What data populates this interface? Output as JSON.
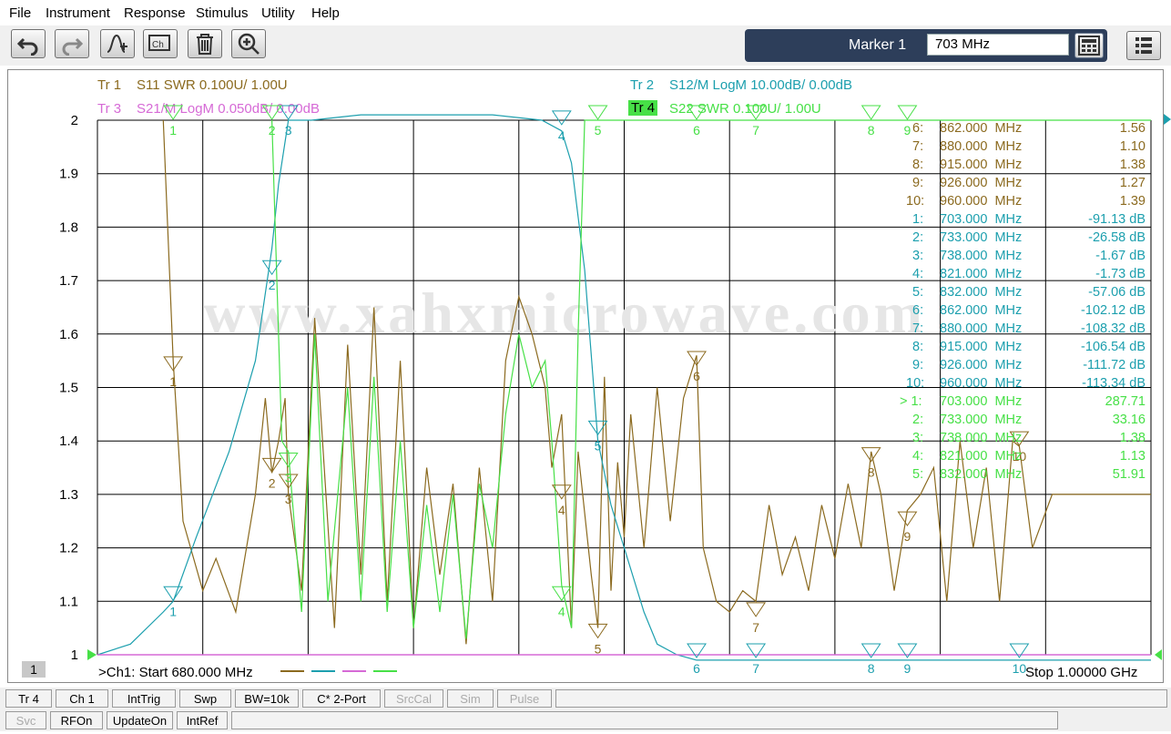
{
  "menu": [
    "File",
    "Instrument",
    "Response",
    "Stimulus",
    "Utility",
    "Help"
  ],
  "toolbar": {
    "buttons": [
      "undo-icon",
      "redo-icon",
      "add-marker-icon",
      "channel-add-icon",
      "trash-icon",
      "zoom-in-icon"
    ],
    "marker_label": "Marker 1",
    "marker_value": "703 MHz"
  },
  "traces": [
    {
      "id": "Tr 1",
      "title": "S11 SWR 0.100U/  1.00U",
      "color": "#8b6a1f"
    },
    {
      "id": "Tr 2",
      "title": "S12/M LogM 10.00dB/  0.00dB",
      "color": "#1c9fae"
    },
    {
      "id": "Tr 3",
      "title": "S21/M LogM 0.050dB/  0.00dB",
      "color": "#d66ad6"
    },
    {
      "id": "Tr 4",
      "title": "S22 SWR 0.100U/  1.00U",
      "color": "#47e047"
    }
  ],
  "watermark": "www.xahxmicrowave.com",
  "channel": "1",
  "footer": {
    "start": ">Ch1:  Start  680.000 MHz",
    "stop": "Stop  1.00000 GHz"
  },
  "chart_data": {
    "type": "line",
    "x_unit": "MHz",
    "xlim": [
      680,
      1000
    ],
    "ylim": [
      1,
      2
    ],
    "yticks": [
      "2",
      "1.9",
      "1.8",
      "1.7",
      "1.6",
      "1.5",
      "1.4",
      "1.3",
      "1.2",
      "1.1",
      "1"
    ],
    "grid": true,
    "marker_table": [
      {
        "label": "6:",
        "freq": "862.000  MHz",
        "value": "1.56",
        "color": "#8b6a1f"
      },
      {
        "label": "7:",
        "freq": "880.000  MHz",
        "value": "1.10",
        "color": "#8b6a1f"
      },
      {
        "label": "8:",
        "freq": "915.000  MHz",
        "value": "1.38",
        "color": "#8b6a1f"
      },
      {
        "label": "9:",
        "freq": "926.000  MHz",
        "value": "1.27",
        "color": "#8b6a1f"
      },
      {
        "label": "10:",
        "freq": "960.000  MHz",
        "value": "1.39",
        "color": "#8b6a1f"
      },
      {
        "label": "1:",
        "freq": "703.000  MHz",
        "value": "-91.13 dB",
        "color": "#1c9fae"
      },
      {
        "label": "2:",
        "freq": "733.000  MHz",
        "value": "-26.58 dB",
        "color": "#1c9fae"
      },
      {
        "label": "3:",
        "freq": "738.000  MHz",
        "value": "-1.67 dB",
        "color": "#1c9fae"
      },
      {
        "label": "4:",
        "freq": "821.000  MHz",
        "value": "-1.73 dB",
        "color": "#1c9fae"
      },
      {
        "label": "5:",
        "freq": "832.000  MHz",
        "value": "-57.06 dB",
        "color": "#1c9fae"
      },
      {
        "label": "6:",
        "freq": "862.000  MHz",
        "value": "-102.12 dB",
        "color": "#1c9fae"
      },
      {
        "label": "7:",
        "freq": "880.000  MHz",
        "value": "-108.32 dB",
        "color": "#1c9fae"
      },
      {
        "label": "8:",
        "freq": "915.000  MHz",
        "value": "-106.54 dB",
        "color": "#1c9fae"
      },
      {
        "label": "9:",
        "freq": "926.000  MHz",
        "value": "-111.72 dB",
        "color": "#1c9fae"
      },
      {
        "label": "10:",
        "freq": "960.000  MHz",
        "value": "-113.34 dB",
        "color": "#1c9fae"
      },
      {
        "label": "> 1:",
        "freq": "703.000  MHz",
        "value": "287.71",
        "color": "#47e047"
      },
      {
        "label": "2:",
        "freq": "733.000  MHz",
        "value": "33.16",
        "color": "#47e047"
      },
      {
        "label": "3:",
        "freq": "738.000  MHz",
        "value": "1.38",
        "color": "#47e047"
      },
      {
        "label": "4:",
        "freq": "821.000  MHz",
        "value": "1.13",
        "color": "#47e047"
      },
      {
        "label": "5:",
        "freq": "832.000  MHz",
        "value": "51.91",
        "color": "#47e047"
      }
    ],
    "series": [
      {
        "name": "Tr 1",
        "color": "#8b6a1f",
        "x": [
          700,
          703,
          706,
          712,
          716,
          722,
          728,
          731,
          733,
          735,
          737,
          738,
          742,
          746,
          752,
          756,
          760,
          764,
          768,
          772,
          776,
          780,
          784,
          788,
          792,
          796,
          800,
          804,
          808,
          812,
          816,
          818,
          821,
          824,
          826,
          830,
          832,
          834,
          836,
          838,
          840,
          842,
          846,
          850,
          854,
          858,
          862,
          864,
          868,
          872,
          876,
          880,
          884,
          888,
          892,
          896,
          900,
          904,
          908,
          912,
          915,
          918,
          922,
          926,
          930,
          934,
          938,
          942,
          946,
          950,
          954,
          958,
          960,
          964,
          970,
          980,
          990,
          1000
        ],
        "y": [
          2,
          1.55,
          1.25,
          1.12,
          1.18,
          1.08,
          1.3,
          1.48,
          1.34,
          1.4,
          1.48,
          1.3,
          1.12,
          1.63,
          1.05,
          1.58,
          1.15,
          1.65,
          1.1,
          1.55,
          1.05,
          1.35,
          1.15,
          1.32,
          1.02,
          1.35,
          1.1,
          1.55,
          1.67,
          1.6,
          1.5,
          1.35,
          1.45,
          1.05,
          1.38,
          1.15,
          1.05,
          1.52,
          1.12,
          1.36,
          1.22,
          1.45,
          1.2,
          1.5,
          1.25,
          1.48,
          1.56,
          1.2,
          1.1,
          1.08,
          1.12,
          1.1,
          1.28,
          1.15,
          1.22,
          1.12,
          1.28,
          1.18,
          1.32,
          1.2,
          1.38,
          1.3,
          1.12,
          1.27,
          1.3,
          1.35,
          1.1,
          1.4,
          1.2,
          1.35,
          1.1,
          1.4,
          1.39,
          1.2,
          1.3,
          1.3,
          1.3,
          1.3
        ]
      },
      {
        "name": "Tr 2",
        "color": "#1c9fae",
        "x": [
          680,
          690,
          700,
          703,
          710,
          720,
          728,
          733,
          735,
          738,
          745,
          760,
          780,
          800,
          815,
          821,
          824,
          828,
          832,
          836,
          840,
          846,
          850,
          856,
          862,
          880,
          900,
          915,
          926,
          940,
          960,
          980,
          1000
        ],
        "y": [
          1.0,
          1.02,
          1.08,
          1.1,
          1.22,
          1.38,
          1.55,
          1.76,
          1.88,
          2.0,
          2.0,
          2.01,
          2.01,
          2.01,
          2.0,
          1.98,
          1.92,
          1.72,
          1.4,
          1.28,
          1.2,
          1.08,
          1.02,
          1.0,
          0.99,
          0.99,
          0.99,
          0.99,
          0.99,
          0.99,
          0.99,
          0.99,
          0.99
        ]
      },
      {
        "name": "Tr 3",
        "color": "#d66ad6",
        "x": [
          680,
          1000
        ],
        "y": [
          1.0,
          1.0
        ]
      },
      {
        "name": "Tr 4",
        "color": "#47e047",
        "x": [
          733,
          736,
          738,
          742,
          746,
          750,
          756,
          760,
          764,
          768,
          772,
          776,
          780,
          784,
          788,
          792,
          796,
          800,
          804,
          808,
          812,
          816,
          818,
          821,
          824,
          826,
          828,
          832,
          1000
        ],
        "y": [
          2.0,
          1.4,
          1.38,
          1.08,
          1.6,
          1.1,
          1.5,
          1.1,
          1.52,
          1.08,
          1.4,
          1.05,
          1.28,
          1.08,
          1.3,
          1.03,
          1.32,
          1.2,
          1.45,
          1.6,
          1.5,
          1.55,
          1.4,
          1.13,
          1.05,
          1.6,
          2.0,
          2.0,
          2.0
        ]
      }
    ],
    "markers": [
      {
        "series": 0,
        "labels": [
          "1",
          "2",
          "3",
          "4",
          "5",
          "6",
          "7",
          "8",
          "9",
          "10"
        ],
        "x": [
          703,
          733,
          738,
          821,
          832,
          862,
          880,
          915,
          926,
          960
        ],
        "y": [
          1.53,
          1.34,
          1.31,
          1.29,
          1.03,
          1.54,
          1.07,
          1.36,
          1.24,
          1.39
        ]
      },
      {
        "series": 1,
        "labels": [
          "1",
          "2",
          "3",
          "4",
          "5",
          "6",
          "7",
          "8",
          "9",
          "10"
        ],
        "x": [
          703,
          733,
          738,
          821,
          832,
          862,
          880,
          915,
          926,
          960
        ],
        "y": [
          1.1,
          1.71,
          2.0,
          1.99,
          1.41,
          0.99,
          0.99,
          0.99,
          0.99,
          0.99
        ]
      },
      {
        "series": 3,
        "labels": [
          "1",
          "2",
          "3",
          "4",
          "5",
          "6",
          "7",
          "8",
          "9"
        ],
        "x": [
          703,
          733,
          738,
          821,
          832,
          862,
          880,
          915,
          926
        ],
        "y": [
          2.0,
          2.0,
          1.35,
          1.1,
          2.0,
          2.0,
          2.0,
          2.0,
          2.0
        ]
      }
    ]
  },
  "status1": [
    "Tr 4",
    "Ch 1",
    "IntTrig",
    "Swp",
    "BW=10k",
    "C* 2-Port",
    "SrcCal",
    "Sim",
    "Pulse"
  ],
  "status2": [
    "Svc",
    "RFOn",
    "UpdateOn",
    "IntRef"
  ]
}
